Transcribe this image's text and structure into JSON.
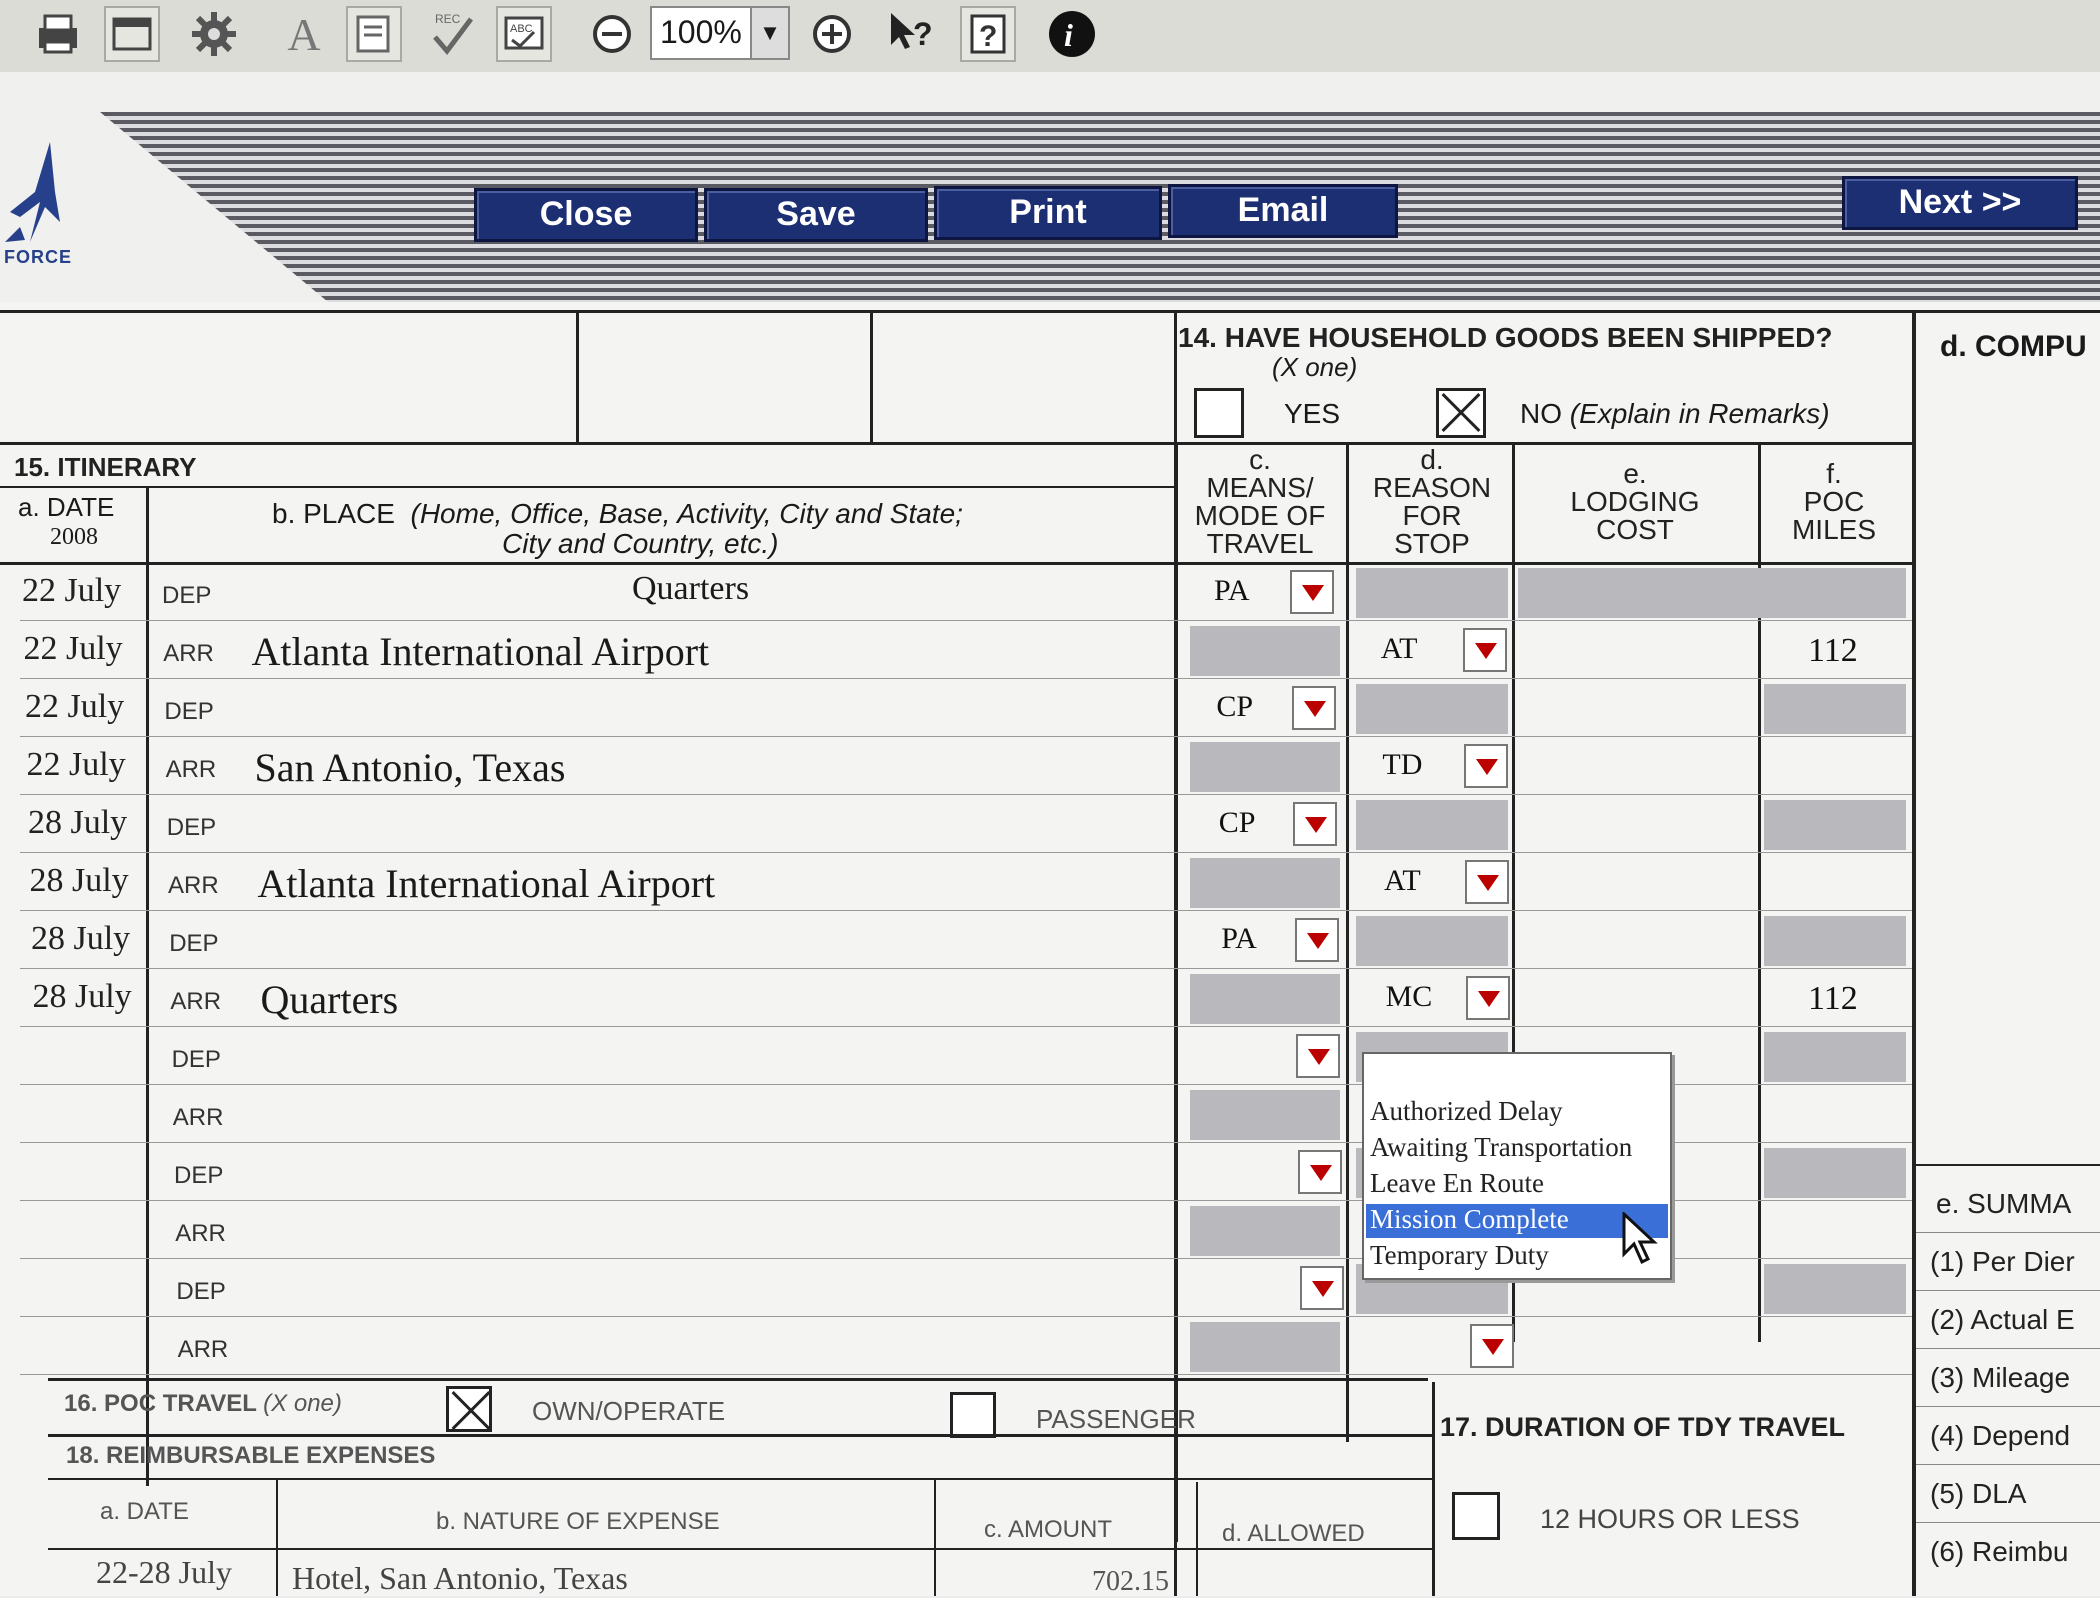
{
  "toolbar": {
    "zoom": "100%",
    "icons": [
      "printer-icon",
      "window-icon",
      "settings-icon",
      "text-icon",
      "form-icon",
      "check-icon",
      "field-icon",
      "zoom-out-icon",
      "zoom-in-icon",
      "whats-this-icon",
      "help-icon",
      "info-icon"
    ]
  },
  "banner": {
    "logo_text": "FORCE",
    "buttons": {
      "close": "Close",
      "save": "Save",
      "print": "Print",
      "email": "Email",
      "next": "Next >>"
    }
  },
  "section14": {
    "title": "14. HAVE HOUSEHOLD GOODS BEEN SHIPPED?",
    "subtitle": "(X one)",
    "yes_label": "YES",
    "no_label": "NO",
    "no_note": "(Explain in Remarks)",
    "yes_checked": false,
    "no_checked": true
  },
  "right_col": {
    "d_label": "d.  COMPU",
    "summary_label": "e.  SUMMA",
    "items": [
      "(1)  Per Dier",
      "(2)  Actual E",
      "(3)  Mileage",
      "(4)  Depend",
      "(5)  DLA",
      "(6)  Reimbu"
    ]
  },
  "itinerary": {
    "title": "15. ITINERARY",
    "col_a": "a. DATE",
    "col_a_year": "2008",
    "col_b": "b. PLACE",
    "col_b_note1": "(Home, Office, Base, Activity, City and State;",
    "col_b_note2": "City and Country, etc.)",
    "col_c": [
      "c.",
      "MEANS/",
      "MODE OF",
      "TRAVEL"
    ],
    "col_d": [
      "d.",
      "REASON",
      "FOR",
      "STOP"
    ],
    "col_e": [
      "e.",
      "LODGING",
      "COST"
    ],
    "col_f": [
      "f.",
      "POC",
      "MILES"
    ],
    "rows": [
      {
        "date": "22 July",
        "type": "DEP",
        "place": "Quarters",
        "means": "PA",
        "reason": "",
        "lodging": "",
        "miles": ""
      },
      {
        "date": "22 July",
        "type": "ARR",
        "place": "Atlanta International Airport",
        "means": "",
        "reason": "AT",
        "lodging": "",
        "miles": "112"
      },
      {
        "date": "22 July",
        "type": "DEP",
        "place": "",
        "means": "CP",
        "reason": "",
        "lodging": "",
        "miles": ""
      },
      {
        "date": "22 July",
        "type": "ARR",
        "place": "San Antonio, Texas",
        "means": "",
        "reason": "TD",
        "lodging": "",
        "miles": ""
      },
      {
        "date": "28 July",
        "type": "DEP",
        "place": "",
        "means": "CP",
        "reason": "",
        "lodging": "",
        "miles": ""
      },
      {
        "date": "28 July",
        "type": "ARR",
        "place": "Atlanta International Airport",
        "means": "",
        "reason": "AT",
        "lodging": "",
        "miles": ""
      },
      {
        "date": "28 July",
        "type": "DEP",
        "place": "",
        "means": "PA",
        "reason": "",
        "lodging": "",
        "miles": ""
      },
      {
        "date": "28 July",
        "type": "ARR",
        "place": "Quarters",
        "means": "",
        "reason": "MC",
        "lodging": "",
        "miles": "112"
      },
      {
        "date": "",
        "type": "DEP",
        "place": "",
        "means": "",
        "reason": "",
        "lodging": "",
        "miles": ""
      },
      {
        "date": "",
        "type": "ARR",
        "place": "",
        "means": "",
        "reason": "",
        "lodging": "",
        "miles": ""
      },
      {
        "date": "",
        "type": "DEP",
        "place": "",
        "means": "",
        "reason": "",
        "lodging": "",
        "miles": ""
      },
      {
        "date": "",
        "type": "ARR",
        "place": "",
        "means": "",
        "reason": "",
        "lodging": "",
        "miles": ""
      },
      {
        "date": "",
        "type": "DEP",
        "place": "",
        "means": "",
        "reason": "",
        "lodging": "",
        "miles": ""
      },
      {
        "date": "",
        "type": "ARR",
        "place": "",
        "means": "",
        "reason": "",
        "lodging": "",
        "miles": ""
      }
    ]
  },
  "reason_dropdown": {
    "options": [
      "Authorized Delay",
      "Awaiting Transportation",
      "Leave En Route",
      "Mission Complete",
      "Temporary Duty"
    ],
    "selected": "Mission Complete"
  },
  "section16": {
    "title": "16. POC TRAVEL",
    "subtitle": "(X one)",
    "own_label": "OWN/OPERATE",
    "passenger_label": "PASSENGER",
    "own_checked": true,
    "passenger_checked": false
  },
  "section17": {
    "title": "17. DURATION OF TDY TRAVEL",
    "option": "12 HOURS OR LESS"
  },
  "section18": {
    "title": "18. REIMBURSABLE EXPENSES",
    "col_a": "a. DATE",
    "col_b": "b. NATURE OF EXPENSE",
    "col_c": "c. AMOUNT",
    "col_d": "d. ALLOWED",
    "rows": [
      {
        "date": "22-28 July",
        "nature": "Hotel, San Antonio, Texas",
        "amount": "702.15"
      }
    ]
  }
}
